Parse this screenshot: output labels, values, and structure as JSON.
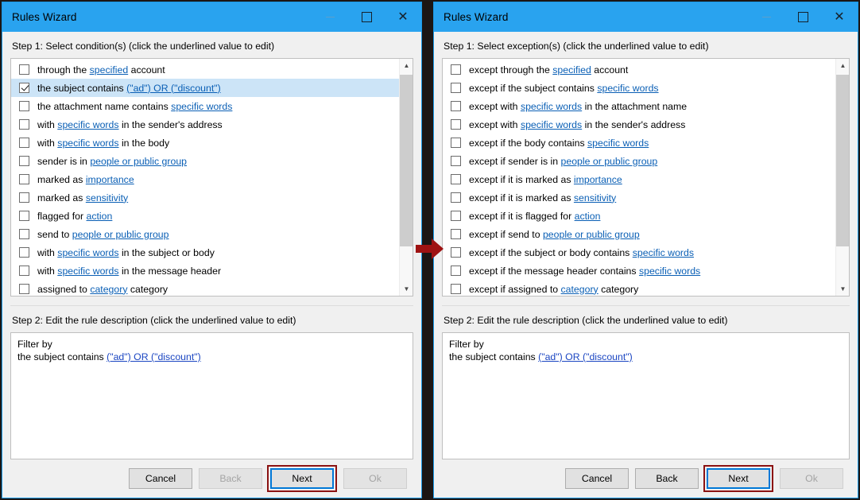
{
  "windows": [
    {
      "title": "Rules Wizard",
      "caption": {
        "minimize": "minimize-icon",
        "maximize": "maximize-icon",
        "close": "close-icon"
      },
      "step1_label": "Step 1: Select condition(s) (click the underlined value to edit)",
      "step2_label": "Step 2: Edit the rule description (click the underlined value to edit)",
      "list": [
        {
          "checked": false,
          "selected": false,
          "parts": [
            {
              "t": "through the ",
              "k": "text"
            },
            {
              "t": "specified",
              "k": "link"
            },
            {
              "t": " account",
              "k": "text"
            }
          ]
        },
        {
          "checked": true,
          "selected": true,
          "parts": [
            {
              "t": "the subject contains ",
              "k": "text"
            },
            {
              "t": "(\"ad\") OR (\"discount\")",
              "k": "link"
            }
          ]
        },
        {
          "checked": false,
          "selected": false,
          "parts": [
            {
              "t": "the attachment name contains ",
              "k": "text"
            },
            {
              "t": "specific words",
              "k": "link"
            }
          ]
        },
        {
          "checked": false,
          "selected": false,
          "parts": [
            {
              "t": "with ",
              "k": "text"
            },
            {
              "t": "specific words",
              "k": "link"
            },
            {
              "t": " in the sender's address",
              "k": "text"
            }
          ]
        },
        {
          "checked": false,
          "selected": false,
          "parts": [
            {
              "t": "with ",
              "k": "text"
            },
            {
              "t": "specific words",
              "k": "link"
            },
            {
              "t": " in the body",
              "k": "text"
            }
          ]
        },
        {
          "checked": false,
          "selected": false,
          "parts": [
            {
              "t": "sender is in ",
              "k": "text"
            },
            {
              "t": "people or public group",
              "k": "link"
            }
          ]
        },
        {
          "checked": false,
          "selected": false,
          "parts": [
            {
              "t": "marked as ",
              "k": "text"
            },
            {
              "t": "importance",
              "k": "link"
            }
          ]
        },
        {
          "checked": false,
          "selected": false,
          "parts": [
            {
              "t": "marked as ",
              "k": "text"
            },
            {
              "t": "sensitivity",
              "k": "link"
            }
          ]
        },
        {
          "checked": false,
          "selected": false,
          "parts": [
            {
              "t": "flagged for ",
              "k": "text"
            },
            {
              "t": "action",
              "k": "link"
            }
          ]
        },
        {
          "checked": false,
          "selected": false,
          "parts": [
            {
              "t": "send to ",
              "k": "text"
            },
            {
              "t": "people or public group",
              "k": "link"
            }
          ]
        },
        {
          "checked": false,
          "selected": false,
          "parts": [
            {
              "t": "with ",
              "k": "text"
            },
            {
              "t": "specific words",
              "k": "link"
            },
            {
              "t": " in the subject or body",
              "k": "text"
            }
          ]
        },
        {
          "checked": false,
          "selected": false,
          "parts": [
            {
              "t": "with ",
              "k": "text"
            },
            {
              "t": "specific words",
              "k": "link"
            },
            {
              "t": " in the message header",
              "k": "text"
            }
          ]
        },
        {
          "checked": false,
          "selected": false,
          "parts": [
            {
              "t": "assigned to ",
              "k": "text"
            },
            {
              "t": "category",
              "k": "link"
            },
            {
              "t": " category",
              "k": "text"
            }
          ]
        }
      ],
      "scrollbar": {
        "up": "▲",
        "down": "▼",
        "thumb_top_pct": 4,
        "thumb_height_pct": 72
      },
      "description": {
        "line1": "Filter by",
        "line2_prefix": "the subject contains ",
        "line2_link": "(\"ad\") OR (\"discount\")"
      },
      "buttons": [
        {
          "label": "Cancel",
          "state": "enabled",
          "focused": false,
          "highlighted": false
        },
        {
          "label": "Back",
          "state": "disabled",
          "focused": false,
          "highlighted": false
        },
        {
          "label": "Next",
          "state": "enabled",
          "focused": true,
          "highlighted": true
        },
        {
          "label": "Ok",
          "state": "disabled",
          "focused": false,
          "highlighted": false
        }
      ]
    },
    {
      "title": "Rules Wizard",
      "caption": {
        "minimize": "minimize-icon",
        "maximize": "maximize-icon",
        "close": "close-icon"
      },
      "step1_label": "Step 1: Select exception(s) (click the underlined value to edit)",
      "step2_label": "Step 2: Edit the rule description (click the underlined value to edit)",
      "list": [
        {
          "checked": false,
          "selected": false,
          "parts": [
            {
              "t": "except through the ",
              "k": "text"
            },
            {
              "t": "specified",
              "k": "link"
            },
            {
              "t": " account",
              "k": "text"
            }
          ]
        },
        {
          "checked": false,
          "selected": false,
          "parts": [
            {
              "t": "except if the subject contains ",
              "k": "text"
            },
            {
              "t": "specific words",
              "k": "link"
            }
          ]
        },
        {
          "checked": false,
          "selected": false,
          "parts": [
            {
              "t": "except with ",
              "k": "text"
            },
            {
              "t": "specific words",
              "k": "link"
            },
            {
              "t": " in the attachment name",
              "k": "text"
            }
          ]
        },
        {
          "checked": false,
          "selected": false,
          "parts": [
            {
              "t": "except with ",
              "k": "text"
            },
            {
              "t": "specific words",
              "k": "link"
            },
            {
              "t": " in the sender's address",
              "k": "text"
            }
          ]
        },
        {
          "checked": false,
          "selected": false,
          "parts": [
            {
              "t": "except if the body contains ",
              "k": "text"
            },
            {
              "t": "specific words",
              "k": "link"
            }
          ]
        },
        {
          "checked": false,
          "selected": false,
          "parts": [
            {
              "t": "except if sender is in ",
              "k": "text"
            },
            {
              "t": "people or public group",
              "k": "link"
            }
          ]
        },
        {
          "checked": false,
          "selected": false,
          "parts": [
            {
              "t": "except if it is marked as ",
              "k": "text"
            },
            {
              "t": "importance",
              "k": "link"
            }
          ]
        },
        {
          "checked": false,
          "selected": false,
          "parts": [
            {
              "t": "except if it is marked as ",
              "k": "text"
            },
            {
              "t": "sensitivity",
              "k": "link"
            }
          ]
        },
        {
          "checked": false,
          "selected": false,
          "parts": [
            {
              "t": "except if it is flagged for ",
              "k": "text"
            },
            {
              "t": "action",
              "k": "link"
            }
          ]
        },
        {
          "checked": false,
          "selected": false,
          "parts": [
            {
              "t": "except if send to ",
              "k": "text"
            },
            {
              "t": "people or public group",
              "k": "link"
            }
          ]
        },
        {
          "checked": false,
          "selected": false,
          "parts": [
            {
              "t": "except if the subject or body contains ",
              "k": "text"
            },
            {
              "t": "specific words",
              "k": "link"
            }
          ]
        },
        {
          "checked": false,
          "selected": false,
          "parts": [
            {
              "t": "except if the message header contains ",
              "k": "text"
            },
            {
              "t": "specific words",
              "k": "link"
            }
          ]
        },
        {
          "checked": false,
          "selected": false,
          "parts": [
            {
              "t": "except if assigned to ",
              "k": "text"
            },
            {
              "t": "category",
              "k": "link"
            },
            {
              "t": " category",
              "k": "text"
            }
          ]
        }
      ],
      "scrollbar": {
        "up": "▲",
        "down": "▼",
        "thumb_top_pct": 4,
        "thumb_height_pct": 72
      },
      "description": {
        "line1": "Filter by",
        "line2_prefix": "the subject contains ",
        "line2_link": "(\"ad\") OR (\"discount\")"
      },
      "buttons": [
        {
          "label": "Cancel",
          "state": "enabled",
          "focused": false,
          "highlighted": false
        },
        {
          "label": "Back",
          "state": "enabled",
          "focused": false,
          "highlighted": false
        },
        {
          "label": "Next",
          "state": "enabled",
          "focused": true,
          "highlighted": true
        },
        {
          "label": "Ok",
          "state": "disabled",
          "focused": false,
          "highlighted": false
        }
      ]
    }
  ],
  "annotation": {
    "arrow": "right-arrow-icon",
    "arrow_color": "#9e1212",
    "highlight_color": "#8b1212",
    "focus_color": "#0078d7"
  },
  "colors": {
    "titlebar": "#29a3ef",
    "window_border": "#1a9ae8",
    "selection": "#cce4f7",
    "link": "#0a5fb5",
    "desc_link": "#1b46c2",
    "backdrop": "#1c1614"
  }
}
